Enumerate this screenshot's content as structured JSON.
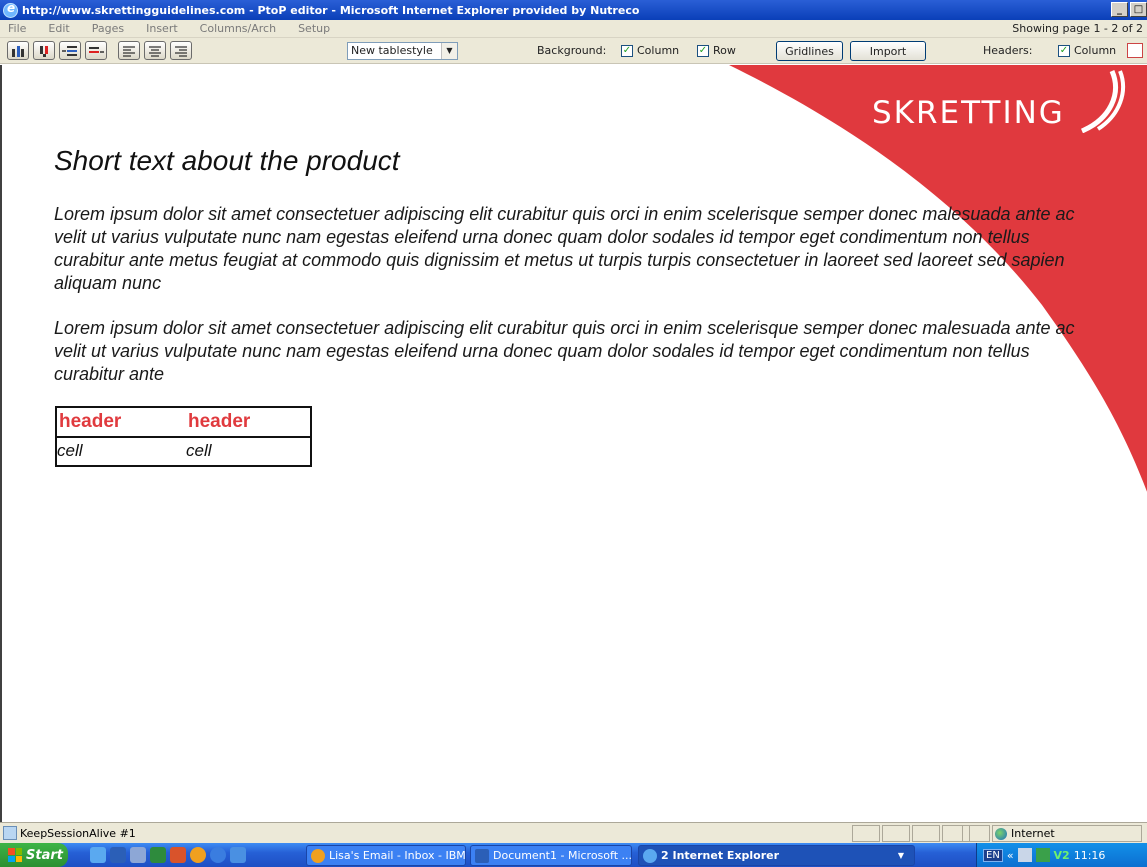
{
  "window": {
    "title": "http://www.skrettingguidelines.com - PtoP editor - Microsoft Internet Explorer provided by Nutreco",
    "controls": [
      "_",
      " ",
      "×"
    ]
  },
  "menu": {
    "items": [
      "File",
      "Edit",
      "Pages",
      "Insert",
      "Columns/Arch",
      "Setup"
    ],
    "paging": "Showing page 1 - 2 of 2"
  },
  "toolbar": {
    "tablestyle_value": "New tablestyle",
    "background_label": "Background:",
    "bg_column_label": "Column",
    "bg_row_label": "Row",
    "bg_column_checked": true,
    "bg_row_checked": true,
    "gridlines_label": "Gridlines",
    "import_label": "Import",
    "headers_label": "Headers:",
    "headers_column_label": "Column",
    "check_mark": "✓"
  },
  "page": {
    "brand": "SKRETTING",
    "brand_color": "#e0393e",
    "heading": "Short text about the product",
    "paragraph1": "Lorem ipsum dolor sit amet consectetuer adipiscing elit curabitur quis orci in enim scelerisque semper donec malesuada ante ac velit ut varius vulputate nunc nam egestas eleifend urna donec quam dolor sodales id tempor eget condimentum non tellus curabitur ante metus feugiat at commodo quis dignissim et metus ut turpis turpis consectetuer in laoreet sed laoreet sed sapien aliquam nunc",
    "paragraph2": "Lorem ipsum dolor sit amet consectetuer adipiscing elit curabitur quis orci in enim scelerisque semper donec malesuada ante ac velit ut varius vulputate nunc nam egestas eleifend urna donec quam dolor sodales id tempor eget condimentum non tellus curabitur ante",
    "table": {
      "headers": [
        "header",
        "header"
      ],
      "rows": [
        [
          "cell",
          "cell"
        ]
      ]
    }
  },
  "statusbar": {
    "message": "KeepSessionAlive #1",
    "zone": "Internet"
  },
  "taskbar": {
    "start": "Start",
    "tasks": [
      "Lisa's Email - Inbox - IBM...",
      "Document1 - Microsoft ...",
      "2 Internet Explorer"
    ],
    "tray_lang": "EN",
    "tray_chevron": "«",
    "tray_app": "V2",
    "clock": "11:16"
  }
}
